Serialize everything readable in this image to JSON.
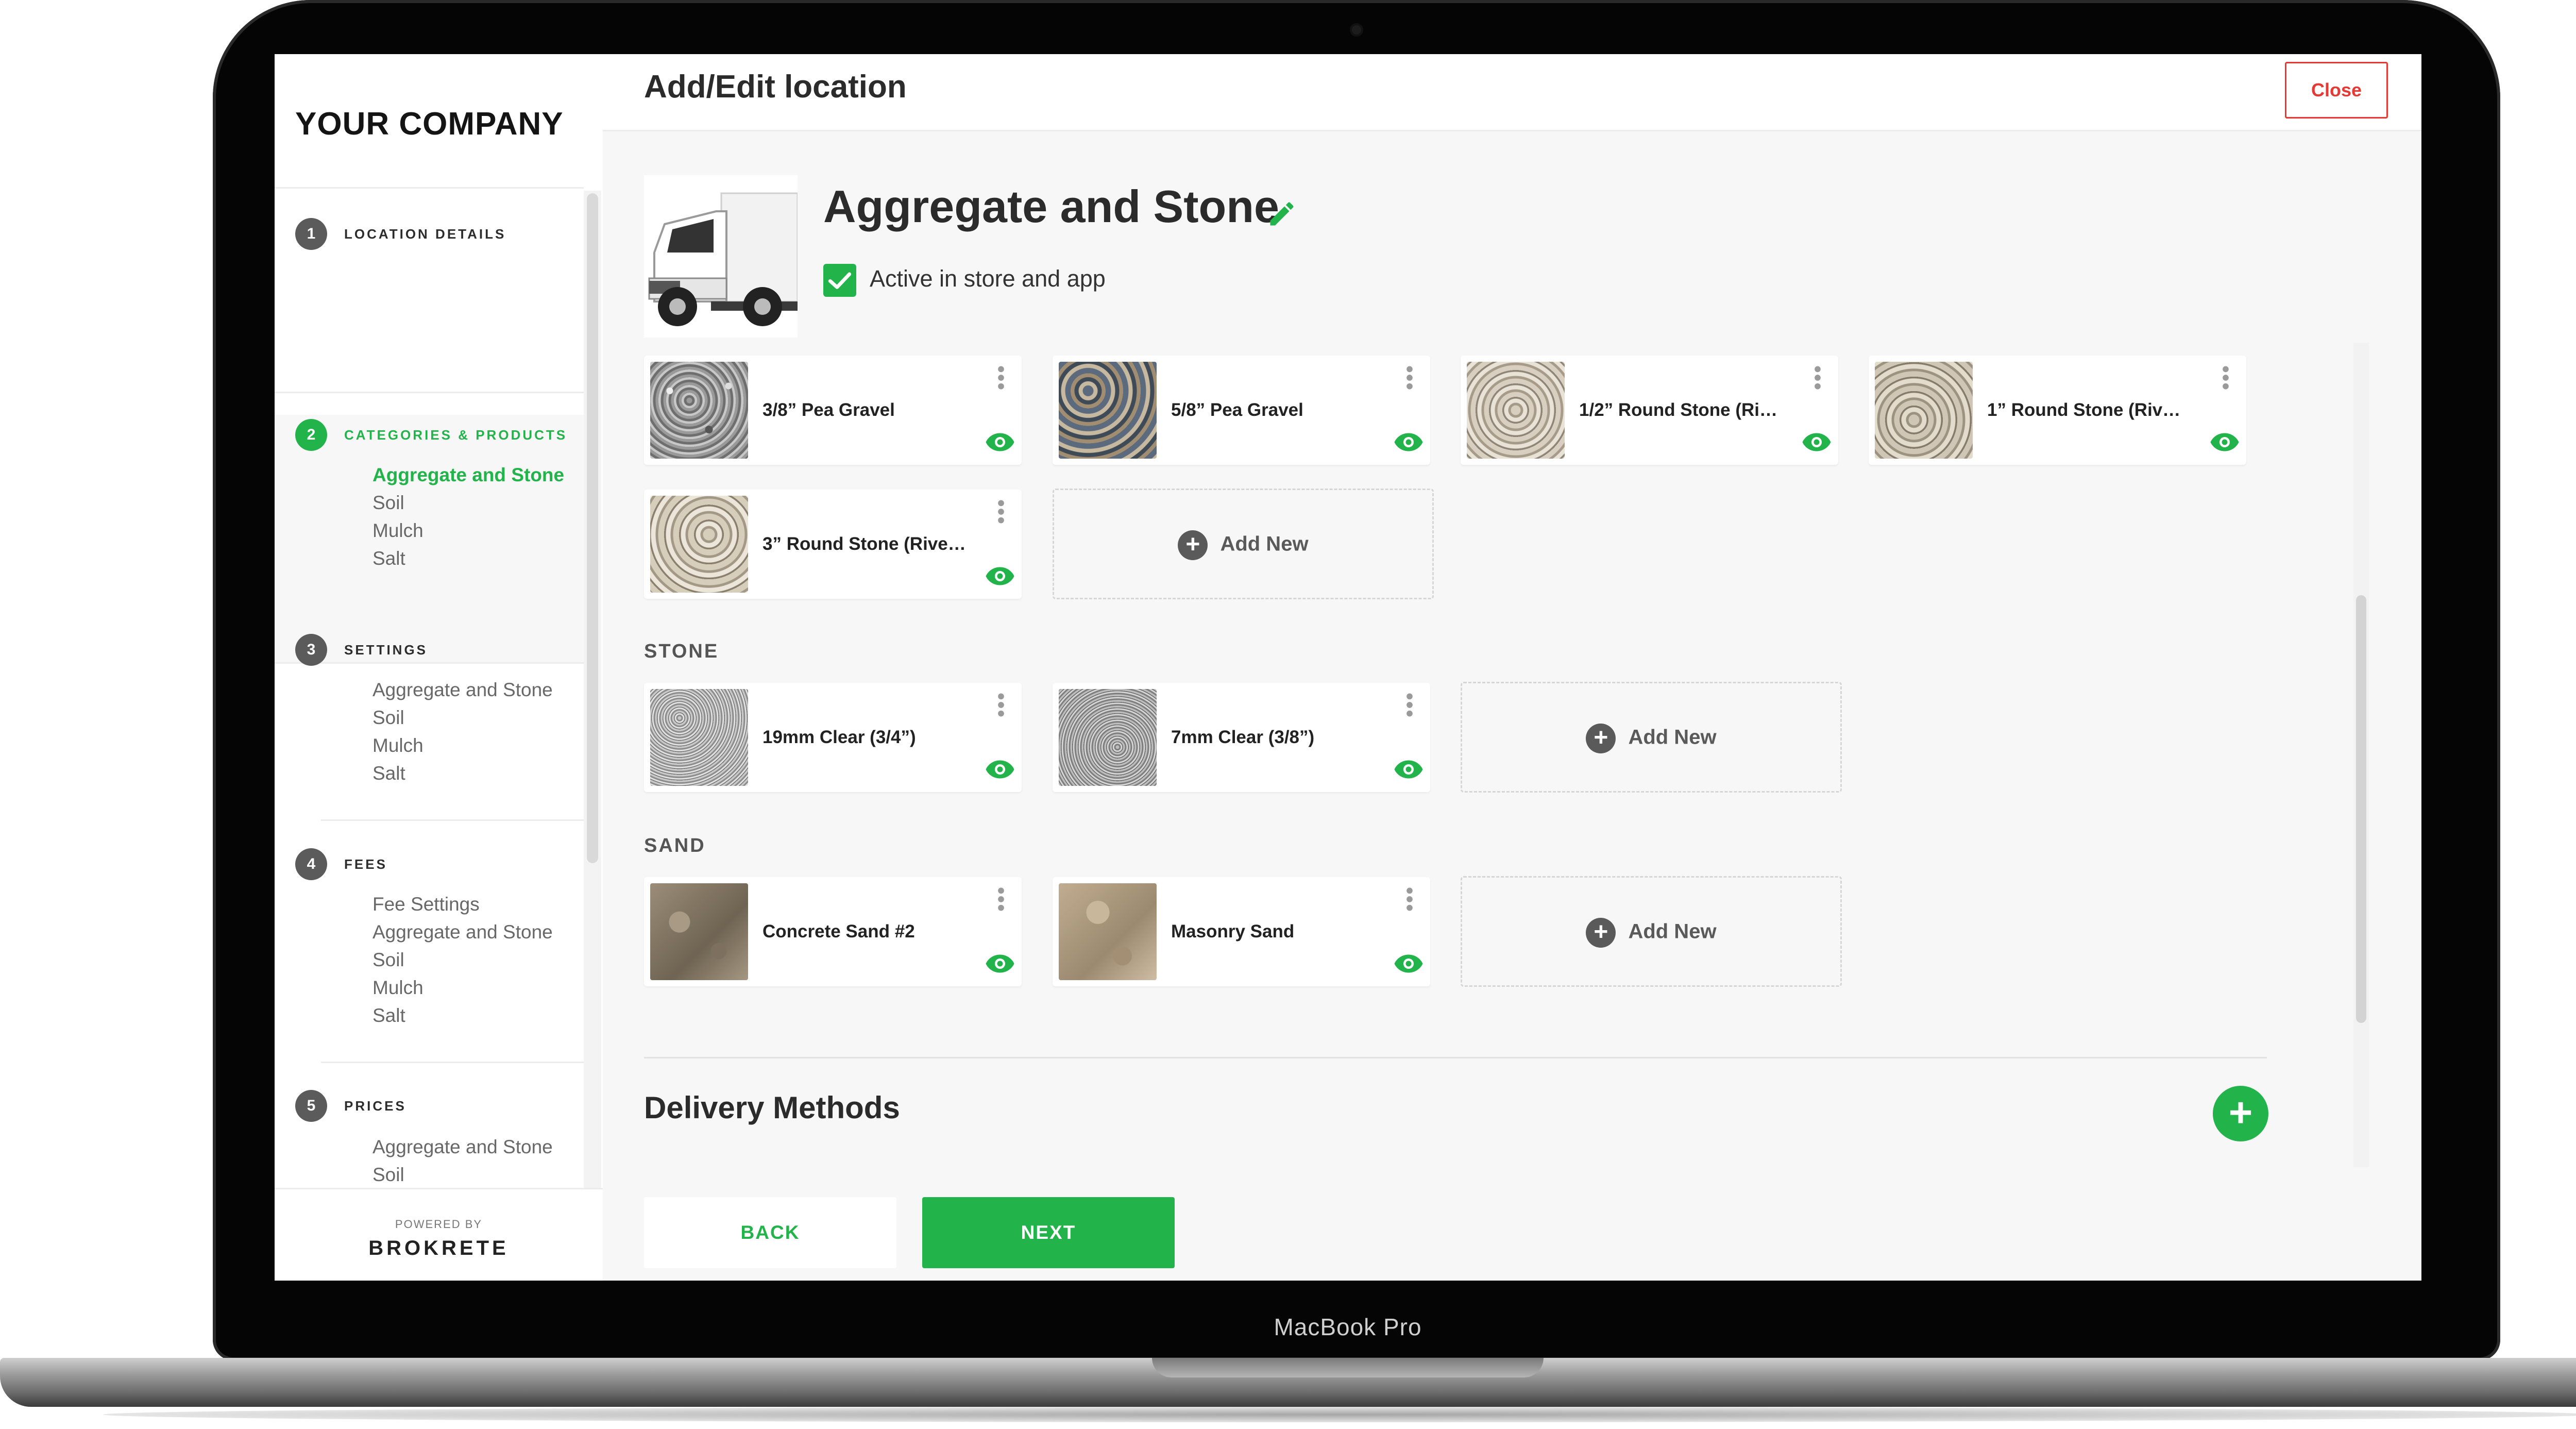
{
  "device": {
    "label": "MacBook Pro"
  },
  "sidebar": {
    "company": "YOUR COMPANY",
    "steps": [
      {
        "num": "1",
        "title": "LOCATION DETAILS",
        "items": []
      },
      {
        "num": "2",
        "title": "CATEGORIES & PRODUCTS",
        "items": [
          "Aggregate and Stone",
          "Soil",
          "Mulch",
          "Salt"
        ],
        "active_item": "Aggregate and Stone"
      },
      {
        "num": "3",
        "title": "SETTINGS",
        "items": [
          "Aggregate and Stone",
          "Soil",
          "Mulch",
          "Salt"
        ]
      },
      {
        "num": "4",
        "title": "FEES",
        "items": [
          "Fee Settings",
          "Aggregate and Stone",
          "Soil",
          "Mulch",
          "Salt"
        ]
      },
      {
        "num": "5",
        "title": "PRICES",
        "items": [
          "Aggregate and Stone",
          "Soil"
        ]
      }
    ],
    "powered_by": "POWERED BY",
    "brand": "BROKRETE"
  },
  "header": {
    "title": "Add/Edit location",
    "close_label": "Close"
  },
  "category": {
    "title": "Aggregate and Stone",
    "active_label": "Active in store and app",
    "active": true,
    "icons": {
      "edit": "pencil-icon",
      "image": "truck-image"
    }
  },
  "sections": [
    {
      "label": "",
      "products": [
        "3/8” Pea Gravel",
        "5/8” Pea Gravel",
        "1/2” Round Stone (Ri…",
        "1” Round Stone (Riv…",
        "3” Round Stone (Rive…"
      ]
    },
    {
      "label": "STONE",
      "products": [
        "19mm Clear (3/4”)",
        "7mm Clear (3/8”)"
      ]
    },
    {
      "label": "SAND",
      "products": [
        "Concrete Sand #2",
        "Masonry Sand"
      ]
    }
  ],
  "add_new_label": "Add New",
  "delivery": {
    "title": "Delivery Methods"
  },
  "footer": {
    "back_label": "BACK",
    "next_label": "NEXT"
  },
  "colors": {
    "accent": "#22b34a",
    "danger": "#e53935",
    "text": "#2b2b2b"
  }
}
